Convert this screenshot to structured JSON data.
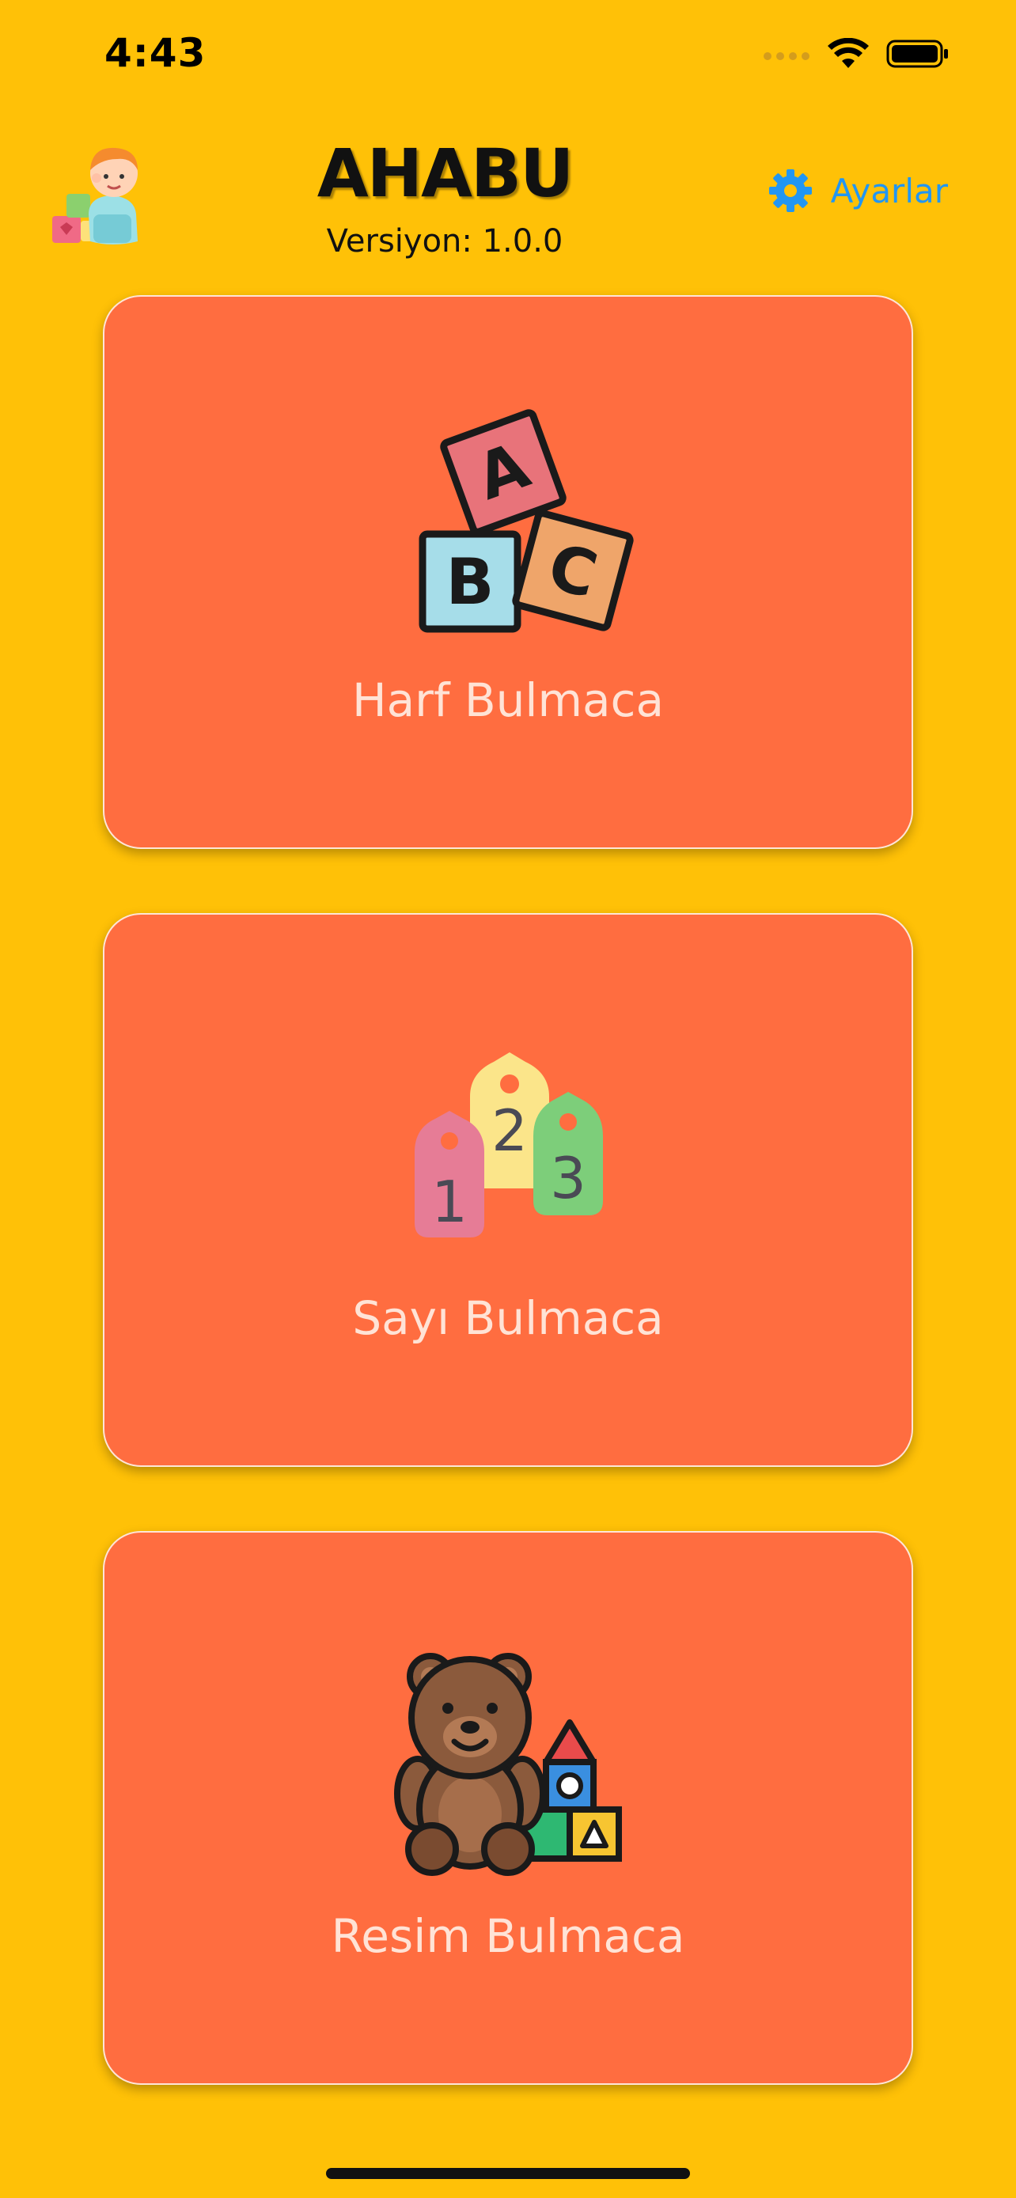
{
  "status_bar": {
    "time": "4:43"
  },
  "header": {
    "title": "AHABU",
    "version": "Versiyon: 1.0.0",
    "settings_label": "Ayarlar"
  },
  "cards": [
    {
      "label": "Harf Bulmaca",
      "icon": "abc-blocks-icon"
    },
    {
      "label": "Sayı Bulmaca",
      "icon": "number-tags-icon"
    },
    {
      "label": "Resim Bulmaca",
      "icon": "teddy-bear-toys-icon"
    }
  ],
  "colors": {
    "background": "#FFC107",
    "card": "#FF6D40",
    "card_text": "#FFE3D6",
    "accent": "#2196F3"
  }
}
